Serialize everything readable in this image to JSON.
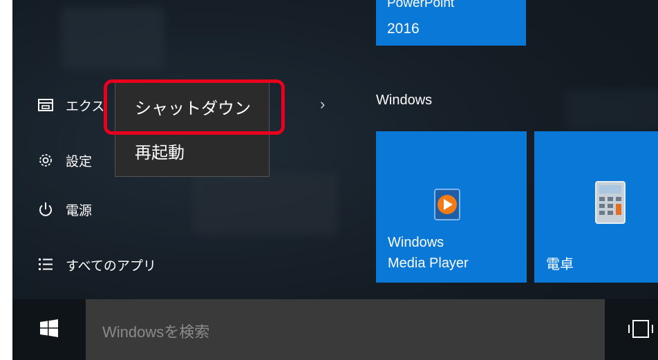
{
  "start_menu": {
    "left": {
      "explorer_label": "エクス",
      "settings_label": "設定",
      "power_label": "電源",
      "all_apps_label": "すべてのアプリ",
      "chevron": "›"
    },
    "power_menu": {
      "items": [
        {
          "label": "シャットダウン",
          "highlighted": true
        },
        {
          "label": "再起動"
        }
      ]
    },
    "tiles": {
      "powerpoint": {
        "line1": "PowerPoint",
        "line2": "2016"
      },
      "group_title": "Windows",
      "media_player": {
        "line1": "Windows",
        "line2": "Media Player"
      },
      "calculator": {
        "label": "電卓"
      }
    }
  },
  "taskbar": {
    "search_placeholder": "Windowsを検索"
  },
  "colors": {
    "tile_blue": "#0a78d7",
    "highlight_red": "#e8001c",
    "menu_bg": "#2b2b2b"
  },
  "icons": {
    "explorer": "folder-icon",
    "settings": "gear-icon",
    "power": "power-icon",
    "all_apps": "list-icon",
    "start": "windows-logo-icon",
    "task_view": "task-view-icon",
    "media_player": "media-player-icon",
    "calculator": "calculator-icon"
  }
}
